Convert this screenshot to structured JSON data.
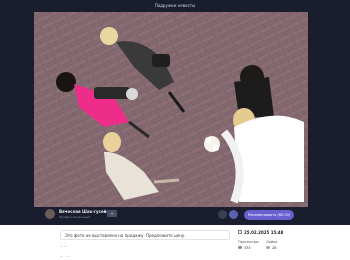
{
  "viewer": {
    "title": "Подружки невесты"
  },
  "author": {
    "name": "Вячеслав Шах-гусейнов",
    "status": "Профессиональный"
  },
  "actions": {
    "add_friend_icon": "plus-icon",
    "favorite_icon": "heart-icon",
    "share_icon": "share-icon",
    "primary_label": "Рекомендовать (60.00)"
  },
  "details": {
    "description": "Это фото не выставлено на продажу. Предложите цену.",
    "date": "25.02.2025 15:48",
    "views_label": "Просмотры",
    "views_count": "335",
    "likes_label": "Лайки",
    "likes_count": "28",
    "footer_line_1": "— —",
    "footer_line_2": "—  ·  —  ·"
  },
  "colors": {
    "viewer_bg": "#1a1d2e",
    "accent": "#6a5fd0",
    "page_bg": "#ffffff"
  }
}
